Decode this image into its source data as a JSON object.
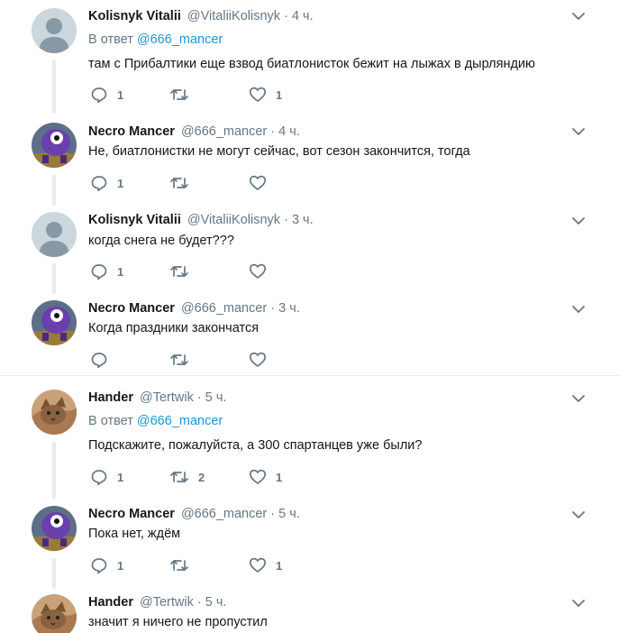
{
  "tweets": [
    {
      "author": "Kolisnyk Vitalii",
      "handle": "@VitaliiKolisnyk",
      "time": "4 ч.",
      "reply_prefix": "В ответ",
      "reply_to": "@666_mancer",
      "text": "там с Прибалтики еще  взвод биатлонисток бежит на лыжах в дырляндию",
      "reply_count": "1",
      "retweet_count": "",
      "like_count": "1",
      "avatar": "default-avatar"
    },
    {
      "author": "Necro Mancer",
      "handle": "@666_mancer",
      "time": "4 ч.",
      "text": "Не, биатлонистки не могут сейчас, вот сезон закончится, тогда",
      "reply_count": "1",
      "retweet_count": "",
      "like_count": "",
      "avatar": "monster-avatar"
    },
    {
      "author": "Kolisnyk Vitalii",
      "handle": "@VitaliiKolisnyk",
      "time": "3 ч.",
      "text": "когда снега не будет???",
      "reply_count": "1",
      "retweet_count": "",
      "like_count": "",
      "avatar": "default-avatar"
    },
    {
      "author": "Necro Mancer",
      "handle": "@666_mancer",
      "time": "3 ч.",
      "text": "Когда праздники закончатся",
      "reply_count": "",
      "retweet_count": "",
      "like_count": "",
      "avatar": "monster-avatar"
    },
    {
      "author": "Hander",
      "handle": "@Tertwik",
      "time": "5 ч.",
      "reply_prefix": "В ответ",
      "reply_to": "@666_mancer",
      "text": "Подскажите, пожалуйста, а 300 спартанцев уже были?",
      "reply_count": "1",
      "retweet_count": "2",
      "like_count": "1",
      "avatar": "cat-avatar"
    },
    {
      "author": "Necro Mancer",
      "handle": "@666_mancer",
      "time": "5 ч.",
      "text": "Пока нет, ждём",
      "reply_count": "1",
      "retweet_count": "",
      "like_count": "1",
      "avatar": "monster-avatar"
    },
    {
      "author": "Hander",
      "handle": "@Tertwik",
      "time": "5 ч.",
      "text": "значит я ничего не пропустил",
      "avatar": "cat-avatar"
    }
  ],
  "separator": "·",
  "colors": {
    "link": "#1b95e0",
    "secondary_text": "#657786",
    "primary_text": "#14171a",
    "thread_line": "#e6ecf0"
  }
}
